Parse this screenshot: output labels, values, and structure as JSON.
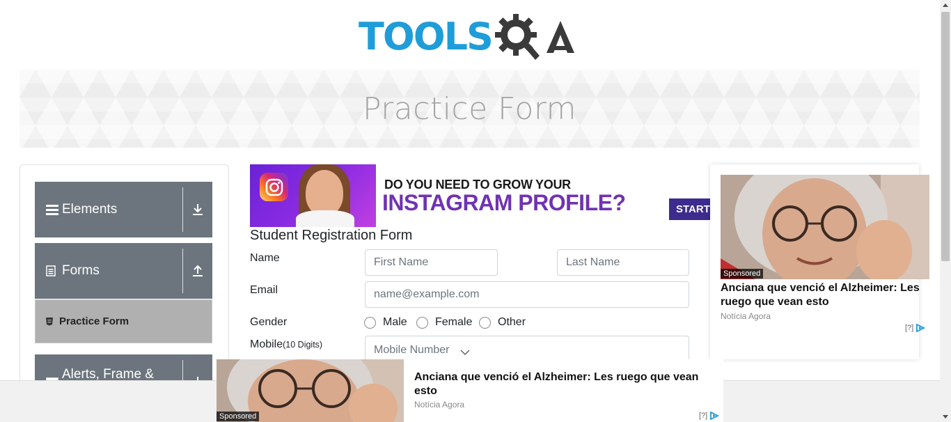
{
  "logo": {
    "text": "TOOLS",
    "suffix": "A"
  },
  "banner": {
    "title": "Practice Form"
  },
  "sidebar": {
    "groups": [
      {
        "label": "Elements",
        "icon": "list-icon",
        "arrow": "download-arrow-icon"
      },
      {
        "label": "Forms",
        "icon": "document-icon",
        "arrow": "upload-arrow-icon"
      },
      {
        "label": "Alerts, Frame & Windows",
        "icon": "window-icon",
        "arrow": "download-arrow-icon"
      }
    ],
    "active_item": {
      "label": "Practice Form",
      "icon": "html-icon"
    }
  },
  "insta_ad": {
    "line1": "DO YOU NEED TO GROW YOUR",
    "line2": "INSTAGRAM PROFILE?",
    "button": "START"
  },
  "form": {
    "title": "Student Registration Form",
    "name_label": "Name",
    "first_name_placeholder": "First Name",
    "last_name_placeholder": "Last Name",
    "email_label": "Email",
    "email_placeholder": "name@example.com",
    "gender_label": "Gender",
    "gender_options": [
      "Male",
      "Female",
      "Other"
    ],
    "mobile_label": "Mobile",
    "mobile_hint": "(10 Digits)",
    "mobile_placeholder": "Mobile Number"
  },
  "right_ad": {
    "sponsored": "Sponsored",
    "headline": "Anciana que venció el Alzheimer: Les ruego que vean esto",
    "source": "Notícia Agora",
    "adchoice": "[?]"
  },
  "bottom_ad": {
    "sponsored": "Sponsored",
    "headline": "Anciana que venció el Alzheimer: Les ruego que vean esto",
    "source": "Notícia Agora",
    "adchoice": "[?]"
  },
  "colors": {
    "logo_blue": "#1f9dd9",
    "logo_dark": "#3a3a3a",
    "sidebar_group": "#6c757d",
    "active_item": "#b0b0b0",
    "insta_purple": "#6f33b3"
  }
}
